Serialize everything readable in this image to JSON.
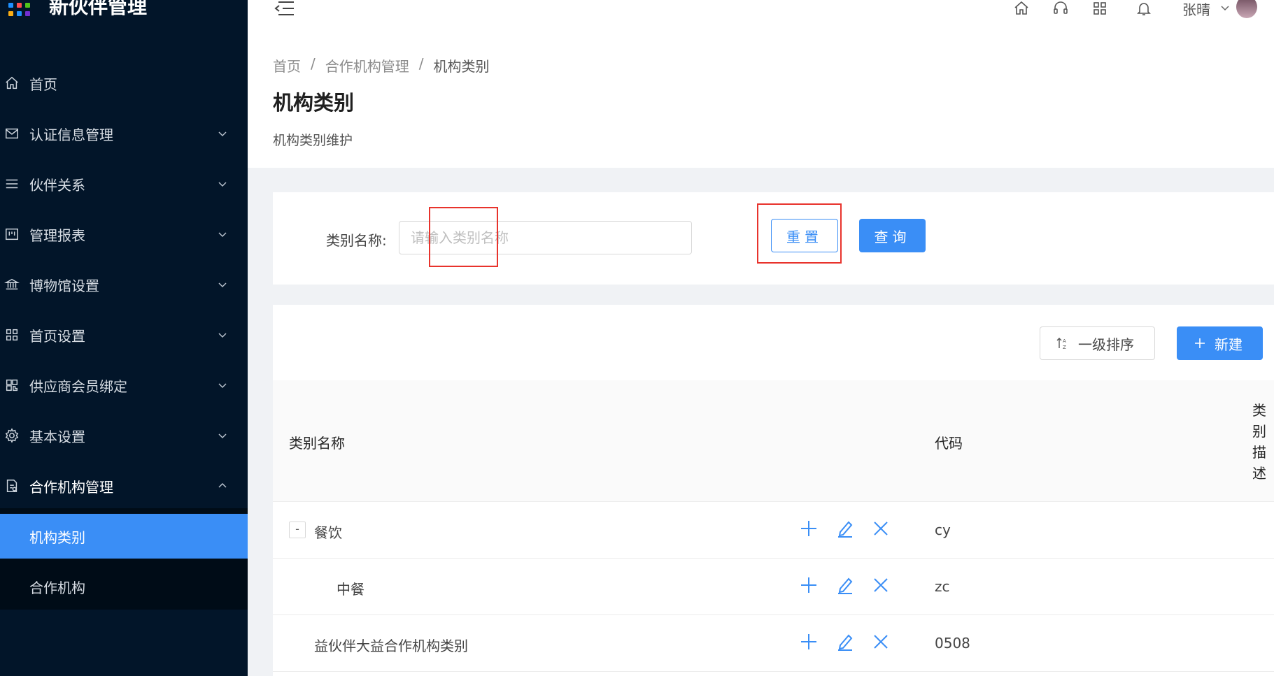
{
  "app": {
    "title": "新伙伴管理"
  },
  "colors": {
    "sidebar_bg": "#021529",
    "primary": "#3a8ef6",
    "highlight_box": "#e8332c"
  },
  "sidebar": {
    "items": [
      {
        "label": "首页",
        "icon": "home-icon"
      },
      {
        "label": "认证信息管理",
        "icon": "mail-icon"
      },
      {
        "label": "伙伴关系",
        "icon": "list-icon"
      },
      {
        "label": "管理报表",
        "icon": "board-icon"
      },
      {
        "label": "博物馆设置",
        "icon": "bank-icon"
      },
      {
        "label": "首页设置",
        "icon": "grid-icon"
      },
      {
        "label": "供应商会员绑定",
        "icon": "qrcode-icon"
      },
      {
        "label": "基本设置",
        "icon": "gear-icon"
      },
      {
        "label": "合作机构管理",
        "icon": "document-icon"
      }
    ],
    "subitems": [
      {
        "label": "机构类别",
        "active": true
      },
      {
        "label": "合作机构",
        "active": false
      }
    ]
  },
  "header": {
    "user_name": "张晴",
    "icons": [
      "menu-fold-icon",
      "home-icon",
      "headset-icon",
      "apps-icon",
      "bell-icon"
    ]
  },
  "breadcrumb": {
    "items": [
      "首页",
      "合作机构管理",
      "机构类别"
    ]
  },
  "page": {
    "title": "机构类别",
    "description": "机构类别维护"
  },
  "search": {
    "label": "类别名称:",
    "placeholder": "请输入类别名称",
    "value": "",
    "reset_label": "重置",
    "query_label": "查询"
  },
  "toolbar": {
    "sort_label": "一级排序",
    "new_label": "新建"
  },
  "table": {
    "columns": {
      "name": "类别名称",
      "code": "代码",
      "desc": "类别描述"
    },
    "rows": [
      {
        "name": "餐饮",
        "code": "cy",
        "expander": "-"
      },
      {
        "name": "中餐",
        "code": "zc"
      },
      {
        "name": "益伙伴大益合作机构类别",
        "code": "0508"
      }
    ]
  }
}
